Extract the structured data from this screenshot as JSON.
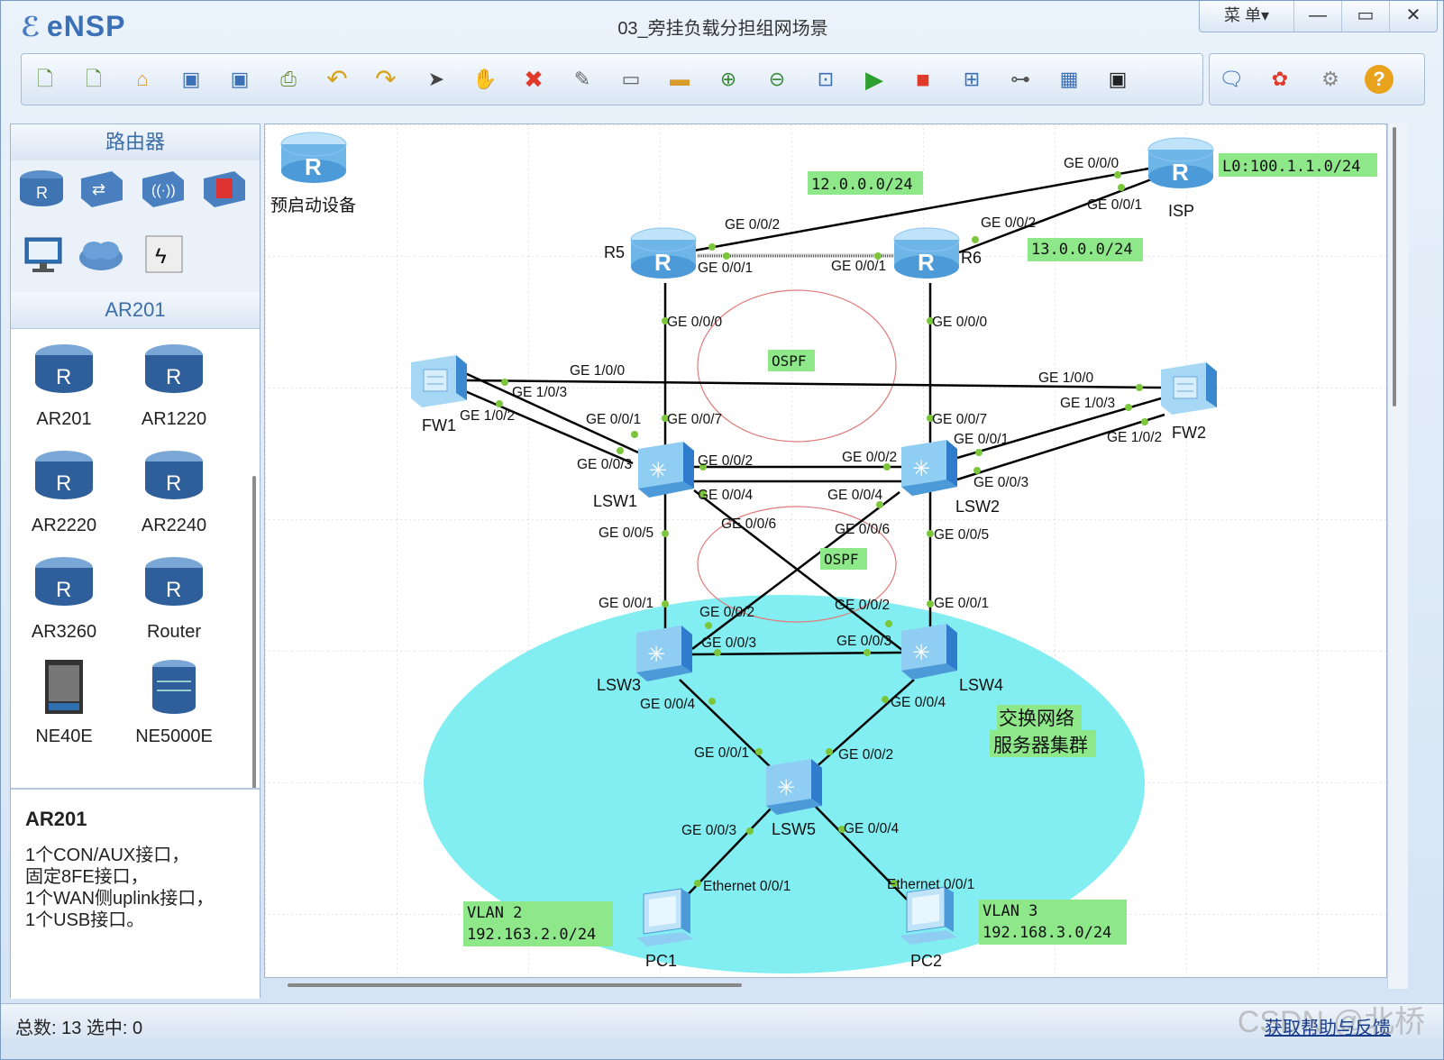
{
  "app": {
    "name": "eNSP",
    "title": "03_旁挂负载分担组网场景"
  },
  "window_controls": {
    "menu": "菜 单▾",
    "minimize": "—",
    "maximize": "▭",
    "close": "✕"
  },
  "toolbar": {
    "icons": [
      "new-topology-icon",
      "new-example-icon",
      "open-icon",
      "save-icon",
      "save-as-icon",
      "print-icon",
      "undo-icon",
      "redo-icon",
      "select-pointer-icon",
      "hand-icon",
      "delete-icon",
      "delete-link-icon",
      "text-icon",
      "rectangle-icon",
      "zoom-in-icon",
      "zoom-out-icon",
      "fit-icon",
      "start-icon",
      "stop-icon",
      "capture-icon",
      "topology-icon",
      "grid-icon",
      "terminal-icon"
    ],
    "right_icons": [
      "chat-icon",
      "huawei-icon",
      "settings-icon",
      "help-icon"
    ]
  },
  "left": {
    "routers_header": "路由器",
    "model_header": "AR201",
    "devices": [
      "AR201",
      "AR1220",
      "AR2220",
      "AR2240",
      "AR3260",
      "Router",
      "NE40E",
      "NE5000E"
    ],
    "description": {
      "name": "AR201",
      "lines": [
        "1个CON/AUX接口，",
        "固定8FE接口，",
        "1个WAN侧uplink接口，",
        "1个USB接口。"
      ]
    }
  },
  "canvas": {
    "prestart_label": "预启动设备",
    "devices": {
      "isp": "ISP",
      "r5": "R5",
      "r6": "R6",
      "fw1": "FW1",
      "fw2": "FW2",
      "lsw1": "LSW1",
      "lsw2": "LSW2",
      "lsw3": "LSW3",
      "lsw4": "LSW4",
      "lsw5": "LSW5",
      "pc1": "PC1",
      "pc2": "PC2"
    },
    "notes": {
      "net12": "12.0.0.0/24",
      "net13": "13.0.0.0/24",
      "loopback": "L0:100.1.1.0/24",
      "ospf1": "OSPF",
      "ospf2": "OSPF",
      "cluster_line1": "交换网络",
      "cluster_line2": "服务器集群",
      "vlan2_line1": "VLAN 2",
      "vlan2_line2": "192.163.2.0/24",
      "vlan3_line1": "VLAN 3",
      "vlan3_line2": "192.168.3.0/24"
    },
    "ports": {
      "isp_g0": "GE 0/0/0",
      "isp_g1": "GE 0/0/1",
      "r5_g2": "GE 0/0/2",
      "r5_g1": "GE 0/0/1",
      "r5_g0": "GE 0/0/0",
      "r6_g2": "GE 0/0/2",
      "r6_g1": "GE 0/0/1",
      "r6_g0": "GE 0/0/0",
      "fw1_g100": "GE 1/0/0",
      "fw1_g103": "GE 1/0/3",
      "fw1_g102": "GE 1/0/2",
      "fw2_g100": "GE 1/0/0",
      "fw2_g103": "GE 1/0/3",
      "fw2_g102": "GE 1/0/2",
      "lsw1_g1": "GE 0/0/1",
      "lsw1_g7": "GE 0/0/7",
      "lsw1_g3": "GE 0/0/3",
      "lsw1_g2": "GE 0/0/2",
      "lsw1_g4": "GE 0/0/4",
      "lsw1_g6": "GE 0/0/6",
      "lsw1_g5": "GE 0/0/5",
      "lsw2_g7": "GE 0/0/7",
      "lsw2_g1": "GE 0/0/1",
      "lsw2_g2": "GE 0/0/2",
      "lsw2_g3": "GE 0/0/3",
      "lsw2_g4": "GE 0/0/4",
      "lsw2_g6": "GE 0/0/6",
      "lsw2_g5": "GE 0/0/5",
      "lsw3_g1": "GE 0/0/1",
      "lsw3_g2": "GE 0/0/2",
      "lsw3_g3": "GE 0/0/3",
      "lsw3_g4": "GE 0/0/4",
      "lsw4_g2": "GE 0/0/2",
      "lsw4_g1": "GE 0/0/1",
      "lsw4_g3": "GE 0/0/3",
      "lsw4_g4": "GE 0/0/4",
      "lsw5_g1": "GE 0/0/1",
      "lsw5_g2": "GE 0/0/2",
      "lsw5_g3": "GE 0/0/3",
      "lsw5_g4": "GE 0/0/4",
      "pc1_eth": "Ethernet 0/0/1",
      "pc2_eth": "Ethernet 0/0/1"
    }
  },
  "status": {
    "count": "总数: 13  选中: 0",
    "help": "获取帮助与反馈",
    "watermark": "CSDN @北桥"
  },
  "colors": {
    "accent": "#3b6fb6",
    "note_bg": "#8ee88a",
    "cluster": "#82eef2",
    "link": "#000000",
    "port_dot": "#7bc63a",
    "ospf_ring": "#e07a7a"
  }
}
